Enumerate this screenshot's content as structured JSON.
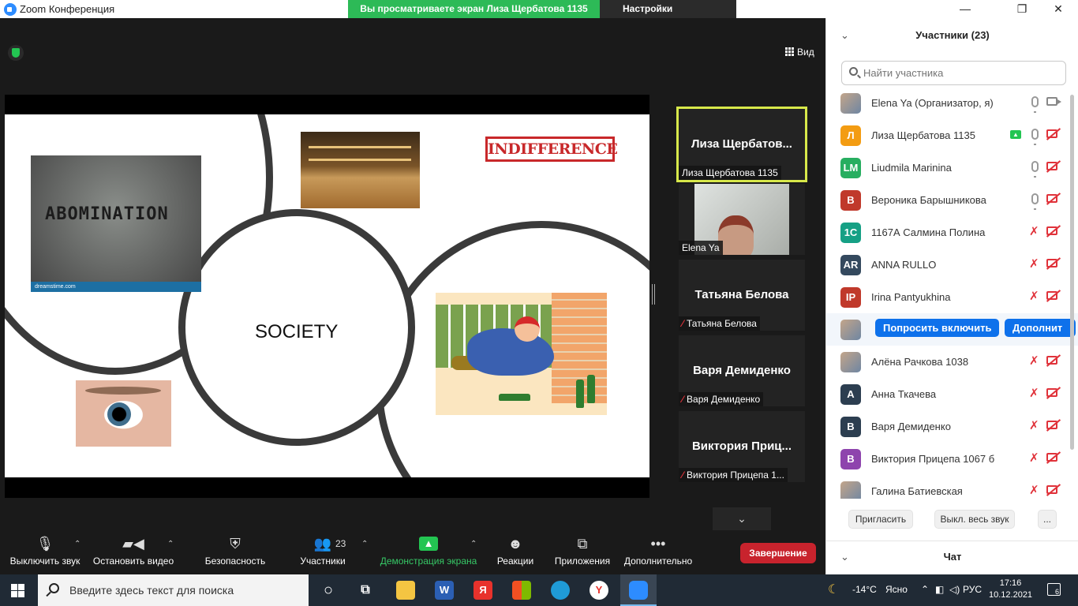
{
  "window": {
    "title": "Zoom Конференция",
    "share_banner": "Вы просматриваете экран Лиза Щербатова 1135",
    "view_settings": "Настройки просмотра",
    "view_button": "Вид",
    "controls": [
      "minimize-icon",
      "restore-icon",
      "close-icon"
    ]
  },
  "slide": {
    "center_text": "SOCIETY",
    "abomination_text": "ABOMINATION",
    "abomination_footer": "dreamstime.com",
    "indifference_text": "INDIFFERENCE"
  },
  "thumbnails": [
    {
      "big_name": "Лиза  Щербатов...",
      "label": "Лиза Щербатова 1135",
      "active": true,
      "muted": false
    },
    {
      "big_name": "",
      "label": "Elena Ya",
      "active": false,
      "muted": false,
      "video": true
    },
    {
      "big_name": "Татьяна Белова",
      "label": "Татьяна Белова",
      "active": false,
      "muted": true
    },
    {
      "big_name": "Варя Демиденко",
      "label": "Варя Демиденко",
      "active": false,
      "muted": true
    },
    {
      "big_name": "Виктория  Приц...",
      "label": "Виктория Прицепа 1...",
      "active": false,
      "muted": true
    }
  ],
  "toolbar": {
    "mute": "Выключить звук",
    "stop_video": "Остановить видео",
    "security": "Безопасность",
    "participants": "Участники",
    "participants_count": "23",
    "share": "Демонстрация экрана",
    "reactions": "Реакции",
    "apps": "Приложения",
    "more": "Дополнительно",
    "end": "Завершение"
  },
  "panel": {
    "title": "Участники (23)",
    "search_placeholder": "Найти участника",
    "participants": [
      {
        "initials": "",
        "name": "Elena Ya (Организатор, я)",
        "color": "photo",
        "mic": "on",
        "cam": "on"
      },
      {
        "initials": "Л",
        "name": "Лиза Щербатова 1135",
        "color": "#f39c12",
        "mic": "on",
        "cam": "off",
        "sharing": true
      },
      {
        "initials": "LM",
        "name": "Liudmila Marinina",
        "color": "#27ae60",
        "mic": "on",
        "cam": "off"
      },
      {
        "initials": "В",
        "name": "Вероника Барышникова",
        "color": "#c0392b",
        "mic": "on",
        "cam": "off"
      },
      {
        "initials": "1С",
        "name": "1167А Салмина Полина",
        "color": "#16a085",
        "mic": "off",
        "cam": "off"
      },
      {
        "initials": "AR",
        "name": "ANNA RULLO",
        "color": "#34495e",
        "mic": "off",
        "cam": "off"
      },
      {
        "initials": "IP",
        "name": "Irina Pantyukhina",
        "color": "#c0392b",
        "mic": "off",
        "cam": "off"
      },
      {
        "initials": "",
        "name": "",
        "color": "photo",
        "hover": true
      },
      {
        "initials": "",
        "name": "Алёна Рачкова 1038",
        "color": "photo",
        "mic": "off",
        "cam": "off"
      },
      {
        "initials": "А",
        "name": "Анна Ткачева",
        "color": "#2c3e50",
        "mic": "off",
        "cam": "off"
      },
      {
        "initials": "В",
        "name": "Варя Демиденко",
        "color": "#2c3e50",
        "mic": "off",
        "cam": "off"
      },
      {
        "initials": "В",
        "name": "Виктория Прицепа 1067 б",
        "color": "#8e44ad",
        "mic": "off",
        "cam": "off"
      },
      {
        "initials": "",
        "name": "Галина Батиевская",
        "color": "photo",
        "mic": "off",
        "cam": "off"
      }
    ],
    "hover_ask": "Попросить включить",
    "hover_more": "Дополнит",
    "invite": "Пригласить",
    "mute_all": "Выкл. весь звук",
    "more": "...",
    "chat_title": "Чат"
  },
  "taskbar": {
    "search_placeholder": "Введите здесь текст для поиска",
    "weather": "-14°C",
    "weather_desc": "Ясно",
    "language": "РУС",
    "time": "17:16",
    "date": "10.12.2021",
    "notifications": "6",
    "apps": [
      {
        "name": "cortana-icon",
        "label": "○"
      },
      {
        "name": "task-view-icon",
        "label": "⧉"
      },
      {
        "name": "file-explorer-icon",
        "label": ""
      },
      {
        "name": "word-icon",
        "label": "W"
      },
      {
        "name": "yandex-browser-icon",
        "label": "Я"
      },
      {
        "name": "store-icon",
        "label": ""
      },
      {
        "name": "edge-icon",
        "label": ""
      },
      {
        "name": "yandex-icon",
        "label": "Y"
      },
      {
        "name": "zoom-icon",
        "label": ""
      }
    ]
  }
}
